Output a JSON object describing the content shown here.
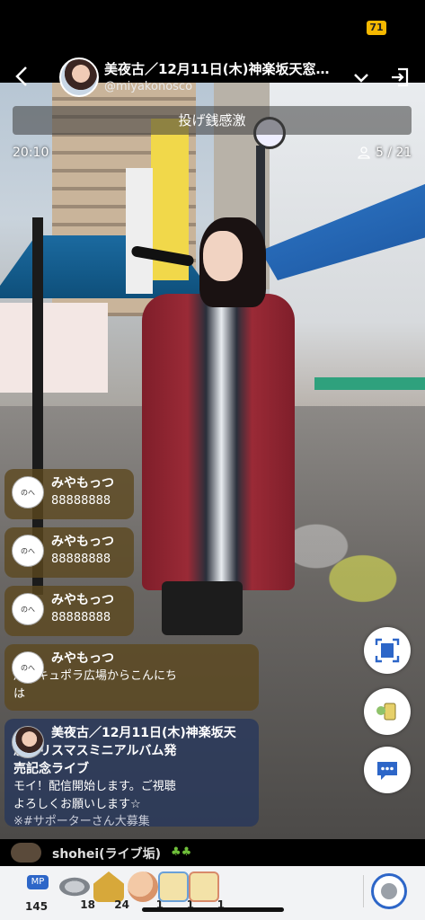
{
  "status": {
    "badge": "71"
  },
  "header": {
    "title": "美夜古／12月11日(木)神楽坂天窓…",
    "handle": "@miyakonosco"
  },
  "gift_banner": "投げ銭感激",
  "stream": {
    "elapsed": "20:10",
    "viewers": "5 / 21"
  },
  "comments": [
    {
      "name": "みやもっつ",
      "text": "88888888"
    },
    {
      "name": "みやもっつ",
      "text": "88888888"
    },
    {
      "name": "みやもっつ",
      "text": "88888888"
    },
    {
      "name": "みやもっつ",
      "text_line1": "川口キュポラ広場からこんにち",
      "text_line2": "は"
    }
  ],
  "broadcaster_comment": {
    "name_line1": "美夜古／12月11日(木)神楽坂天",
    "name_line2": "窓クリスマスミニアルバム発",
    "name_line3": "売記念ライブ",
    "text_line1": "モイ！配信開始します。ご視聴",
    "text_line2": "よろしくお願いします☆",
    "text_line3": "※#サポーターさん大募集"
  },
  "entry": {
    "name": "shohei(ライブ垢)",
    "badge": "♣♣"
  },
  "gifts": [
    {
      "icon": "mp-badge-icon",
      "label": "MP",
      "count": "145"
    },
    {
      "icon": "coin-icon",
      "count": "18"
    },
    {
      "icon": "bonus-p-icon",
      "count": "24"
    },
    {
      "icon": "clap-icon",
      "count": "1"
    },
    {
      "icon": "ticket-a-icon",
      "count": "1"
    },
    {
      "icon": "ticket-b-icon",
      "count": "1"
    }
  ],
  "colors": {
    "comment_bg": "#5c481e",
    "broadcaster_bg": "#28385c",
    "accent_blue": "#2d66c8",
    "status_yellow": "#f5b800"
  }
}
